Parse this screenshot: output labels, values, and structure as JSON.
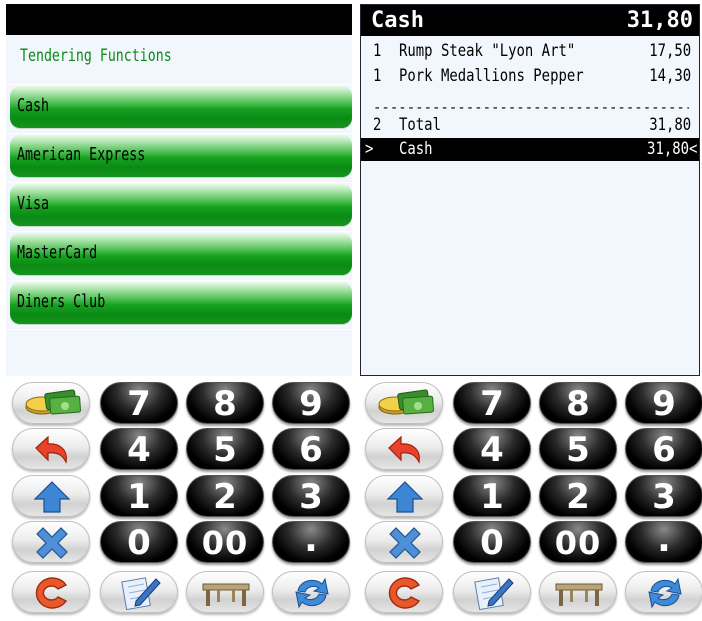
{
  "tendering": {
    "title": "Tendering Functions",
    "buttons": [
      "Cash",
      "American Express",
      "Visa",
      "MasterCard",
      "Diners Club"
    ]
  },
  "receipt": {
    "header": {
      "title": "Cash",
      "amount": "31,80"
    },
    "lines": [
      {
        "qty": "1",
        "desc": "Rump Steak \"Lyon Art\"",
        "amount": "17,50"
      },
      {
        "qty": "1",
        "desc": "Pork Medallions Pepper",
        "amount": "14,30"
      }
    ],
    "divider": "--------------------------------------------------",
    "total": {
      "qty": "2",
      "label": "Total",
      "amount": "31,80"
    },
    "selected": {
      "marker": ">",
      "label": "Cash",
      "amount": "31,80<"
    }
  },
  "keypad": {
    "digits": [
      "7",
      "8",
      "9",
      "4",
      "5",
      "6",
      "1",
      "2",
      "3",
      "0",
      "00",
      "."
    ],
    "function_icons": [
      "money-icon",
      "undo-icon",
      "shift-up-icon",
      "cancel-x-icon"
    ],
    "bottom_icons": [
      "clear-c-icon",
      "notepad-pencil-icon",
      "table-icon",
      "refresh-icon"
    ]
  },
  "colors": {
    "tender_green": "#0e8a16",
    "panel_bg": "#f1f7fc",
    "header_black": "#000000"
  }
}
